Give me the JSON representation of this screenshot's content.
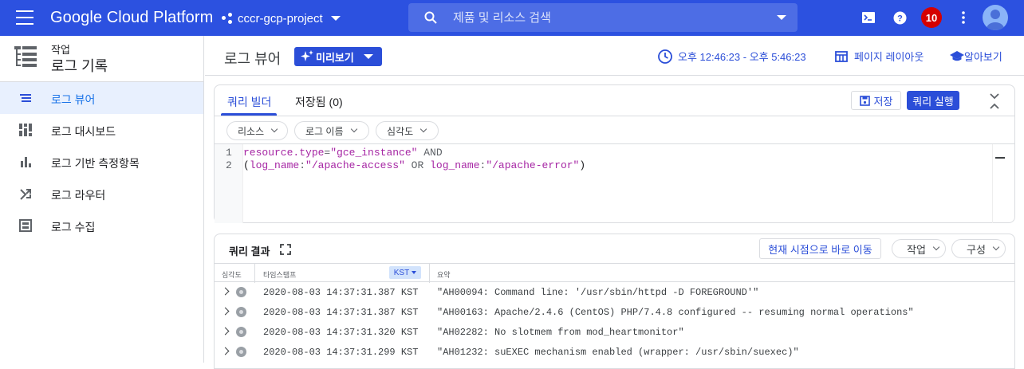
{
  "topbar": {
    "brand": "Google Cloud Platform",
    "project": "cccr-gcp-project",
    "search_placeholder": "제품 및 리소스 검색",
    "notifications_count": "10",
    "icons": [
      "menu-icon",
      "search-icon",
      "cloud-shell-icon",
      "help-icon",
      "more-vert-icon",
      "account-avatar"
    ]
  },
  "sidebar": {
    "section_label": "작업",
    "section_title": "로그 기록",
    "items": [
      {
        "label": "로그 뷰어",
        "icon": "list-icon",
        "active": true
      },
      {
        "label": "로그 대시보드",
        "icon": "dashboard-icon",
        "active": false
      },
      {
        "label": "로그 기반 측정항목",
        "icon": "bar-chart-icon",
        "active": false
      },
      {
        "label": "로그 라우터",
        "icon": "router-icon",
        "active": false
      },
      {
        "label": "로그 수집",
        "icon": "storage-icon",
        "active": false
      }
    ]
  },
  "header": {
    "title": "로그 뷰어",
    "preview_label": "미리보기",
    "time_range": "오후 12:46:23 - 오후 5:46:23",
    "page_layout_label": "페이지 레이아웃",
    "learn_label": "알아보기"
  },
  "query_builder": {
    "tabs": [
      {
        "label": "쿼리 빌더",
        "active": true
      },
      {
        "label": "저장됨 (0)",
        "active": false
      }
    ],
    "save_label": "저장",
    "run_label": "쿼리 실행",
    "filters": [
      "리소스",
      "로그 이름",
      "심각도"
    ],
    "lines": [
      "1",
      "2"
    ],
    "query_line_1": {
      "field": "resource.type",
      "op": "=",
      "value": "\"gce_instance\"",
      "kw": " AND"
    },
    "query_line_2": {
      "open": "(",
      "f1": "log_name",
      "op1": ":",
      "v1": "\"/apache-access\"",
      "kw": " OR ",
      "f2": "log_name",
      "op2": ":",
      "v2": "\"/apache-error\"",
      "close": ")"
    }
  },
  "results": {
    "title": "쿼리 결과",
    "jump_label": "현재 시점으로 바로 이동",
    "actions_label": "작업",
    "config_label": "구성",
    "columns": {
      "severity": "심각도",
      "timestamp": "타임스탬프",
      "timezone": "KST",
      "summary": "요약"
    },
    "rows": [
      {
        "timestamp": "2020-08-03 14:37:31.387 KST",
        "summary": "\"AH00094: Command line: '/usr/sbin/httpd -D FOREGROUND'\""
      },
      {
        "timestamp": "2020-08-03 14:37:31.387 KST",
        "summary": "\"AH00163: Apache/2.4.6 (CentOS) PHP/7.4.8 configured -- resuming normal operations\""
      },
      {
        "timestamp": "2020-08-03 14:37:31.320 KST",
        "summary": "\"AH02282: No slotmem from mod_heartmonitor\""
      },
      {
        "timestamp": "2020-08-03 14:37:31.299 KST",
        "summary": "\"AH01232: suEXEC mechanism enabled (wrapper: /usr/sbin/suexec)\""
      }
    ]
  },
  "colors": {
    "topbar": "#2c51e0",
    "accent": "#2b4ed8",
    "badge": "#d50000"
  }
}
